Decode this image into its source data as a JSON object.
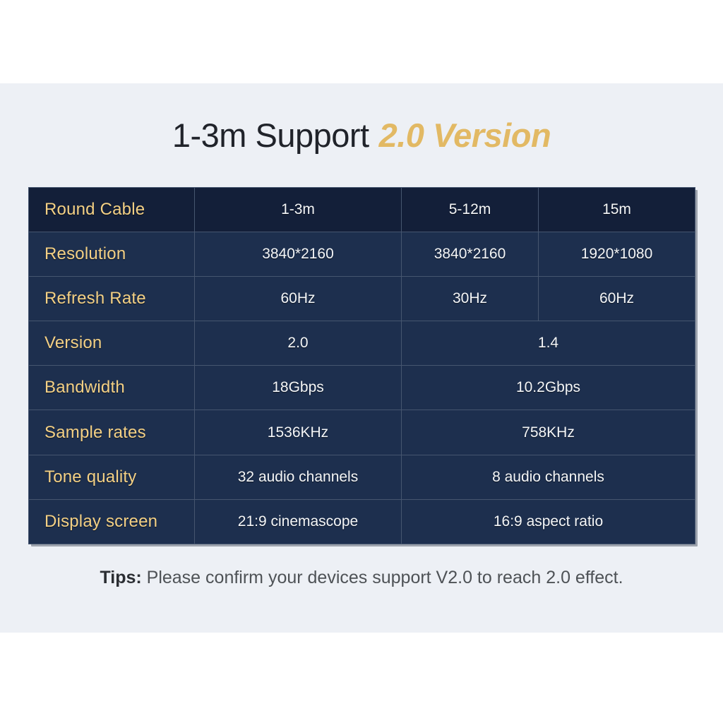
{
  "title": {
    "plain": "1-3m Support",
    "highlight": "2.0 Version"
  },
  "colors": {
    "panel_bg": "#edf0f5",
    "table_bg": "#1d2f4e",
    "table_head_bg": "#131f39",
    "gold": "#f3d085",
    "title_gold": "#e2b964",
    "border": "#46566f",
    "cell_text": "#f4f6f8",
    "shadow": "#9da3ad"
  },
  "table": {
    "rows": [
      {
        "label": "Round Cable",
        "cells": [
          {
            "text": "1-3m",
            "span": 1
          },
          {
            "text": "5-12m",
            "span": 1
          },
          {
            "text": "15m",
            "span": 1
          }
        ]
      },
      {
        "label": "Resolution",
        "cells": [
          {
            "text": "3840*2160",
            "span": 1
          },
          {
            "text": "3840*2160",
            "span": 1
          },
          {
            "text": "1920*1080",
            "span": 1
          }
        ]
      },
      {
        "label": "Refresh Rate",
        "cells": [
          {
            "text": "60Hz",
            "span": 1
          },
          {
            "text": "30Hz",
            "span": 1
          },
          {
            "text": "60Hz",
            "span": 1
          }
        ]
      },
      {
        "label": "Version",
        "cells": [
          {
            "text": "2.0",
            "span": 1
          },
          {
            "text": "1.4",
            "span": 2
          }
        ]
      },
      {
        "label": "Bandwidth",
        "cells": [
          {
            "text": "18Gbps",
            "span": 1
          },
          {
            "text": "10.2Gbps",
            "span": 2
          }
        ]
      },
      {
        "label": "Sample rates",
        "cells": [
          {
            "text": "1536KHz",
            "span": 1
          },
          {
            "text": "758KHz",
            "span": 2
          }
        ]
      },
      {
        "label": "Tone quality",
        "cells": [
          {
            "text": "32 audio channels",
            "span": 1
          },
          {
            "text": "8 audio channels",
            "span": 2
          }
        ]
      },
      {
        "label": "Display screen",
        "cells": [
          {
            "text": "21:9 cinemascope",
            "span": 1
          },
          {
            "text": "16:9 aspect ratio",
            "span": 2
          }
        ]
      }
    ]
  },
  "tips": {
    "label": "Tips:",
    "text": " Please confirm your devices support V2.0 to reach 2.0 effect."
  }
}
